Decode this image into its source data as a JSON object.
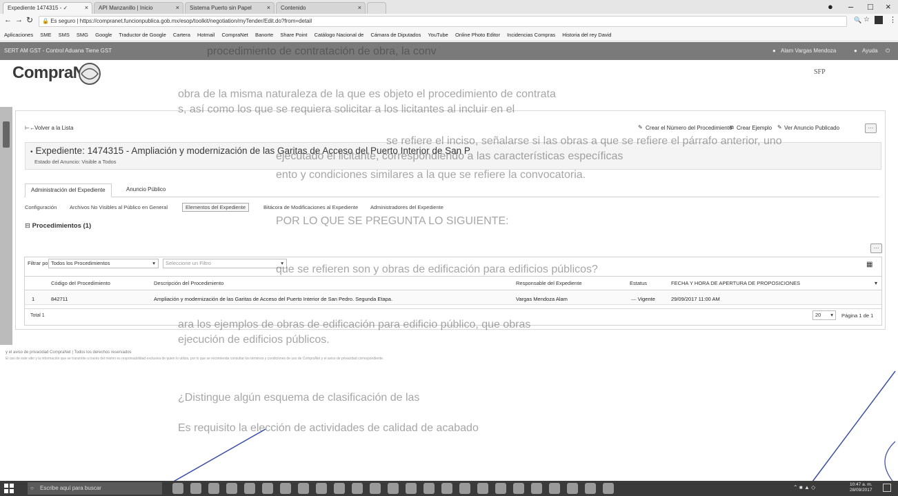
{
  "browser": {
    "tabs": [
      {
        "label": "Expediente 1474315 - ✓"
      },
      {
        "label": "API Manzanillo | Inicio"
      },
      {
        "label": "Sistema Puerto sin Papel"
      },
      {
        "label": "Contenido"
      }
    ],
    "url_secure_label": "Es seguro",
    "url": "https://compranet.funcionpublica.gob.mx/esop/toolkit/negotiation/myTender/Edit.do?from=detail",
    "bookmarks": [
      "Aplicaciones",
      "SME",
      "SMS",
      "SMG",
      "Google",
      "Traductor de Google",
      "Cartera",
      "Hotmail",
      "CompraNet",
      "Banorte",
      "Share Point",
      "Catálogo Nacional de",
      "Cámara de Diputados",
      "YouTube",
      "Online Photo Editor",
      "Incidencias Compras",
      "Historia del rey David"
    ]
  },
  "app": {
    "header_left": "SERT AM GST - Control Aduana Tiene GST",
    "user_name": "Alam Vargas Mendoza",
    "help_label": "Ayuda",
    "logo_text": "CompraNet",
    "seal_text": "SFP"
  },
  "page": {
    "back_label": "Volver a la Lista",
    "actions": [
      "Crear el Número del Procedimiento",
      "Crear Ejemplo",
      "Ver Anuncio Publicado"
    ],
    "more_label": "···",
    "title": "Expediente: 1474315 - Ampliación y modernización de las Garitas de Acceso del Puerto Interior de San P",
    "estado": "Estado del Anuncio: Visible a Todos",
    "tabs": [
      "Administración del Expediente",
      "Anuncio Público"
    ],
    "subtabs": [
      "Configuración",
      "Archivos No Visibles al Público en General",
      "Elementos del Expediente",
      "Bitácora de Modificaciones al Expediente",
      "Administradores del Expediente"
    ],
    "procedimientos_title": "Procedimientos (1)",
    "filter_label": "Filtrar por:",
    "filter_value": "Todos los Procedimientos",
    "filter2_placeholder": "Seleccione un Filtro",
    "columns": [
      "Código del Procedimiento",
      "Descripción del Procedimiento",
      "Responsable del Expediente",
      "Estatus",
      "FECHA Y HORA DE APERTURA DE PROPOSICIONES"
    ],
    "row": {
      "num": "1",
      "codigo": "842711",
      "descripcion": "Ampliación y modernización de las Garitas de Acceso del Puerto Interior de San Pedro. Segunda Etapa.",
      "responsable": "Vargas Mendoza Alam",
      "estatus": "Vigente",
      "fecha": "29/09/2017 11:00 AM"
    },
    "total": "Total 1",
    "page_size": "20",
    "page_info": "Página 1 de 1",
    "fine_print_1": "y el aviso de privacidad CompraNet | Todos los derechos reservados",
    "fine_print_2": "El uso de este sitio y la información que se transmite a través del mismo es responsabilidad exclusiva de quien lo utiliza, por lo que se recomienda consultar los términos y condiciones de uso de CompraNet y el aviso de privacidad correspondiente."
  },
  "scan_text": {
    "line1": "procedimiento de contratación de obra, la conv",
    "line2": "obra de la misma naturaleza de la que es objeto el procedimiento de contrata",
    "line3": "s, así como los que se requiera solicitar a los licitantes al incluir en el",
    "line4": "se refiere el inciso, señalarse si las obras a que se refiere el párrafo anterior, uno",
    "line5": "ejecutado el licitante, correspondiendo a las características específicas",
    "line6": "ento y condiciones similares a la que se refiere la convocatoria.",
    "line7": "POR LO QUE SE PREGUNTA LO SIGUIENTE:",
    "line8": "que se refieren son y obras de edificación para edificios públicos?",
    "line9": "ara los ejemplos de obras de edificación para edificio público, que obras",
    "line10": "ejecución de edificios públicos.",
    "line11": "¿Distingue algún esquema de clasificación de las",
    "line12": "Es requisito la elección de actividades de calidad de acabado"
  },
  "taskbar": {
    "search_placeholder": "Escribe aquí para buscar",
    "time": "10:47 a. m.",
    "date": "28/09/2017"
  }
}
